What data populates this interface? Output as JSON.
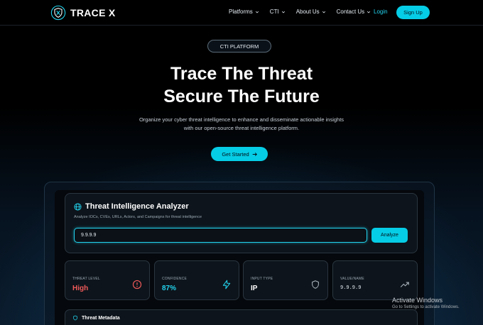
{
  "brand": {
    "name": "TRACE X",
    "logo_icon": "shield-logo-icon"
  },
  "nav": {
    "links": [
      {
        "label": "Platforms"
      },
      {
        "label": "CTI"
      },
      {
        "label": "About Us"
      },
      {
        "label": "Contact Us"
      }
    ],
    "login_label": "Login",
    "signup_label": "Sign Up"
  },
  "hero": {
    "badge": "CTI PLATFORM",
    "title_line1": "Trace The Threat",
    "title_line2": "Secure The Future",
    "subtitle": "Organize your cyber threat intelligence to enhance and disseminate actionable insights with our open-source threat intelligence platform.",
    "cta_label": "Get Started"
  },
  "analyzer": {
    "title": "Threat Intelligence Analyzer",
    "subtitle": "Analyze IOCs, CVEs, URLs, Actors, and Campaigns for threat intelligence",
    "input_value": "9.9.9.9",
    "analyze_label": "Analyze"
  },
  "stats": [
    {
      "label": "THREAT LEVEL",
      "value": "High",
      "color": "#f05a5a",
      "icon": "alert-circle-icon"
    },
    {
      "label": "CONFIDENCE",
      "value": "87%",
      "color": "#22d3ee",
      "icon": "lightning-icon"
    },
    {
      "label": "INPUT TYPE",
      "value": "IP",
      "color": "#ffffff",
      "icon": "shield-icon"
    },
    {
      "label": "VALUE/NAME",
      "value": "9.9.9.9",
      "color": "#e6edf3",
      "icon": "trending-up-icon"
    }
  ],
  "metadata": {
    "title": "Threat Metadata"
  },
  "watermark": {
    "line1": "Activate Windows",
    "line2": "Go to Settings to activate Windows."
  },
  "colors": {
    "accent": "#06cde6",
    "danger": "#f05a5a"
  }
}
